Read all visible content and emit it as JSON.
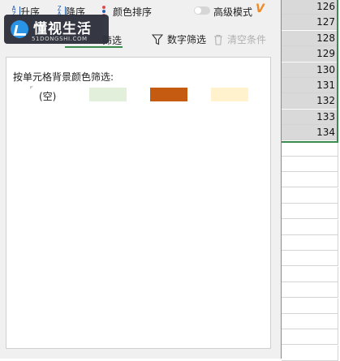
{
  "sort": {
    "asc": "升序",
    "desc": "降序",
    "color_sort": "颜色排序"
  },
  "advanced": {
    "label": "高级模式",
    "badge": "V"
  },
  "logo": {
    "text": "懂视生活",
    "sub": "51DONGSHI.COM"
  },
  "tabs": {
    "color_filter": "筛选",
    "number_filter": "数字筛选",
    "clear_filter": "清空条件"
  },
  "color_panel": {
    "title": "按单元格背景颜色筛选:",
    "blank_label": "(空)",
    "swatches": [
      "#e2efda",
      "#c55a11",
      "#fff2cc"
    ]
  },
  "sheet": {
    "rows": [
      "126",
      "127",
      "128",
      "129",
      "130",
      "131",
      "132",
      "133",
      "134"
    ]
  },
  "colors": {
    "accent_green": "#3c8b4e",
    "cell_fill": "#d9d9d9"
  }
}
